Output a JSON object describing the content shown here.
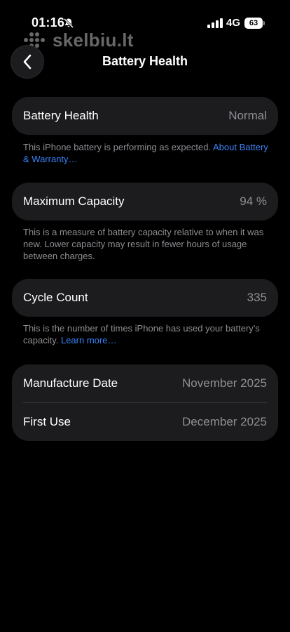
{
  "status_bar": {
    "time": "01:16",
    "network": "4G",
    "battery_level": "63"
  },
  "watermark": {
    "text": "skelbiu.lt"
  },
  "nav": {
    "title": "Battery Health",
    "back_icon": "chevron-left-icon"
  },
  "sections": {
    "battery_health": {
      "label": "Battery Health",
      "value": "Normal",
      "footnote": "This iPhone battery is performing as expected.",
      "link": "About Battery & Warranty…"
    },
    "maximum_capacity": {
      "label": "Maximum Capacity",
      "value": "94 %",
      "footnote": "This is a measure of battery capacity relative to when it was new. Lower capacity may result in fewer hours of usage between charges."
    },
    "cycle_count": {
      "label": "Cycle Count",
      "value": "335",
      "footnote": "This is the number of times iPhone has used your battery's capacity.",
      "link": "Learn more…"
    },
    "dates": {
      "manufacture_label": "Manufacture Date",
      "manufacture_value": "November 2025",
      "first_use_label": "First Use",
      "first_use_value": "December 2025"
    }
  },
  "colors": {
    "background": "#000000",
    "card": "#1c1c1e",
    "secondary_text": "#8e8e93",
    "link": "#3a82f7"
  }
}
